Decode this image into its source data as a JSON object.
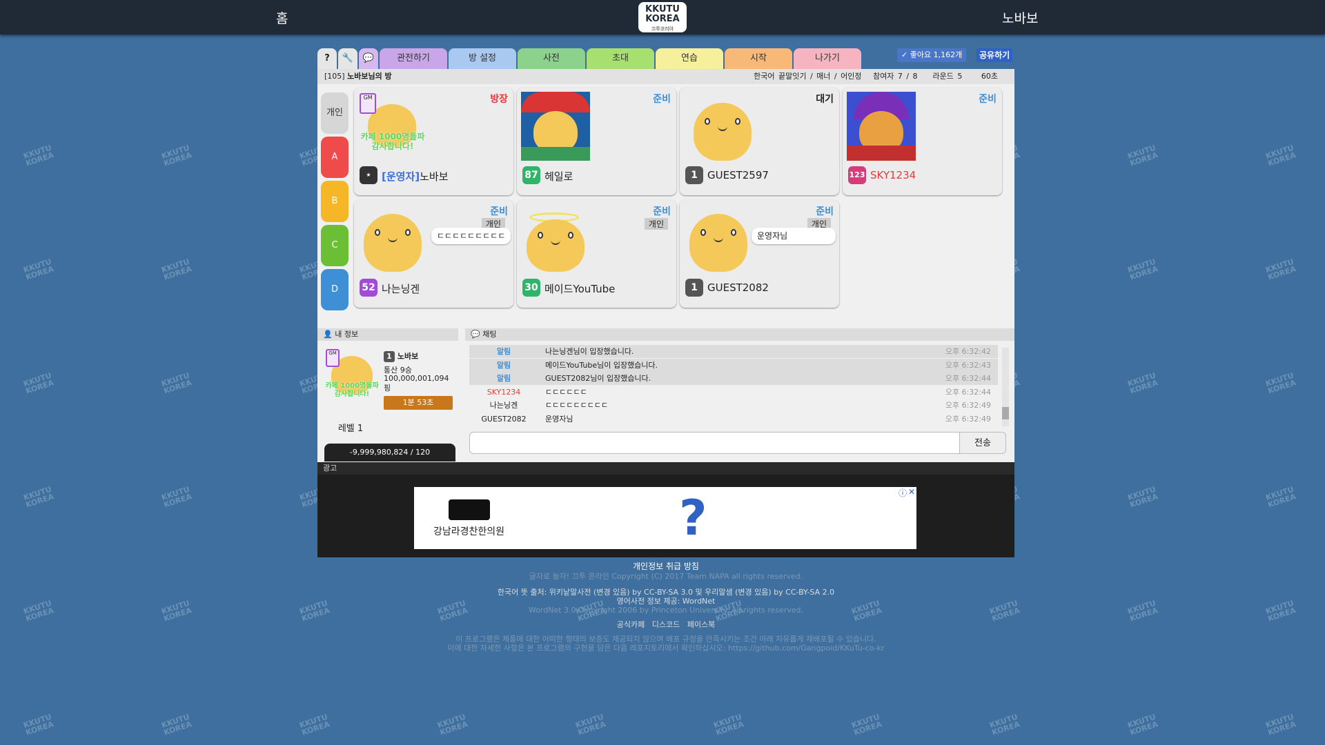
{
  "nav": {
    "home_label": "홈",
    "username": "노바보",
    "logo_text": "KKUTU KOREA",
    "logo_sub": "끄투코리아"
  },
  "tabs": [
    {
      "label": "관전하기",
      "color": "#c9a6e8"
    },
    {
      "label": "방 설정",
      "color": "#a9c9f0"
    },
    {
      "label": "사전",
      "color": "#8cd18c"
    },
    {
      "label": "초대",
      "color": "#a7e06f"
    },
    {
      "label": "연습",
      "color": "#f6ef9b"
    },
    {
      "label": "시작",
      "color": "#f8b878"
    },
    {
      "label": "나가기",
      "color": "#f6b3c0"
    }
  ],
  "icon_tabs": {
    "help": "?",
    "settings": "🔧",
    "chat": "💬"
  },
  "like": {
    "label": "좋아요 1,162개"
  },
  "share": {
    "label": "공유하기"
  },
  "room": {
    "title_num": "[105]",
    "title_name": "노바보님의 방",
    "mode": "한국어 끝말잇기 / 매너 / 어인정",
    "players": "참여자 7 / 8",
    "rounds": "라운드 5",
    "time": "60초"
  },
  "teams": [
    {
      "label": "개인",
      "color": "#d6d6d6"
    },
    {
      "label": "A",
      "color": "#ef4b4b"
    },
    {
      "label": "B",
      "color": "#f5b628"
    },
    {
      "label": "C",
      "color": "#6bbf35"
    },
    {
      "label": "D",
      "color": "#3f8fd6"
    }
  ],
  "players": [
    {
      "name_prefix": "[운영자]",
      "name": "노바보",
      "status": "방장",
      "status_color": "#e53b3b",
      "level": "",
      "level_color": "#333333",
      "avatar_text": "카페 1000명돌파 감사합니다!",
      "team": ""
    },
    {
      "name_prefix": "",
      "name": "헤일로",
      "status": "준비",
      "status_color": "#3f8fd6",
      "level": "87",
      "level_color": "#2fb56a",
      "avatar_text": "",
      "team": ""
    },
    {
      "name_prefix": "",
      "name": "GUEST2597",
      "status": "대기",
      "status_color": "#222222",
      "level": "1",
      "level_color": "#555555",
      "avatar_text": "",
      "team": ""
    },
    {
      "name_prefix": "",
      "name": "SKY1234",
      "status": "준비",
      "status_color": "#3f8fd6",
      "level": "123",
      "level_color": "#d63c7a",
      "avatar_text": "",
      "team": ""
    },
    {
      "name_prefix": "",
      "name": "나는닝겐",
      "status": "준비",
      "status_color": "#3f8fd6",
      "level": "52",
      "level_color": "#a24bd6",
      "avatar_text": "",
      "team": "개인",
      "bubble": "ㄷㄷㄷㄷㄷㄷㄷㄷㄷ"
    },
    {
      "name_prefix": "",
      "name": "메이드YouTube",
      "status": "준비",
      "status_color": "#3f8fd6",
      "level": "30",
      "level_color": "#2fb56a",
      "avatar_text": "",
      "team": "개인"
    },
    {
      "name_prefix": "",
      "name": "GUEST2082",
      "status": "준비",
      "status_color": "#3f8fd6",
      "level": "1",
      "level_color": "#555555",
      "avatar_text": "",
      "team": "개인",
      "bubble": "운영자님"
    }
  ],
  "myinfo": {
    "header": "내 정보",
    "level": "1",
    "name": "노바보",
    "record": "통산 9승",
    "money": "100,000,001,094",
    "money_unit": "핑",
    "playtime": "1분 53초",
    "level_text": "레벨 1",
    "exp": "-9,999,980,824 / 120",
    "avatar_text": "카페 1000명돌파 감사합니다!"
  },
  "chat": {
    "header": "채팅",
    "send_label": "전송",
    "messages": [
      {
        "who": "알림",
        "msg": "나는닝겐님이 입장했습니다.",
        "time": "오후 6:32:42",
        "notice": true,
        "color": "#3f8fd6"
      },
      {
        "who": "알림",
        "msg": "메이드YouTube님이 입장했습니다.",
        "time": "오후 6:32:43",
        "notice": true,
        "color": "#3f8fd6"
      },
      {
        "who": "알림",
        "msg": "GUEST2082님이 입장했습니다.",
        "time": "오후 6:32:44",
        "notice": true,
        "color": "#3f8fd6"
      },
      {
        "who": "SKY1234",
        "msg": "ㄷㄷㄷㄷㄷㄷ",
        "time": "오후 6:32:44",
        "notice": false,
        "color": "#e53b3b"
      },
      {
        "who": "나는닝겐",
        "msg": "ㄷㄷㄷㄷㄷㄷㄷㄷㄷ",
        "time": "오후 6:32:49",
        "notice": false,
        "color": "#222222"
      },
      {
        "who": "GUEST2082",
        "msg": "운영자님",
        "time": "오후 6:32:49",
        "notice": false,
        "color": "#222222"
      }
    ]
  },
  "ad": {
    "header": "광고",
    "brand_text": "강남라경찬한의원",
    "question_mark": "?",
    "close_icon": "✕",
    "info_icon": "ⓘ"
  },
  "footer": {
    "privacy": "개인정보 취급 방침",
    "copyright": "글자로 놀자! 끄투 온라인 Copyright (C) 2017 Team NAPA all rights reserved.",
    "source1": "한국어 뜻 출처: 위키낱말사전 (변경 있음) by CC-BY-SA 3.0 및 우리말샘 (변경 있음) by CC-BY-SA 2.0",
    "source2": "영어사전 정보 제공: WordNet",
    "wordnet": "WordNet 3.0 Copyright 2006 by Princeton University. All rights reserved.",
    "link_cafe": "공식카페",
    "link_discord": "디스코드",
    "link_facebook": "페이스북",
    "license1": "이 프로그램은 제품에 대한 어떠한 형태의 보증도 제공되지 않으며 배포 규정을 만족시키는 조건 아래 자유롭게 재배포될 수 있습니다.",
    "license2": "이에 대한 자세한 사항은 본 프로그램의 구현을 담은 다음 레포지토리에서 확인하십시오: https://github.com/Gangpoid/KKuTu-co-kr"
  },
  "bg_watermark": "KKUTU KOREA"
}
